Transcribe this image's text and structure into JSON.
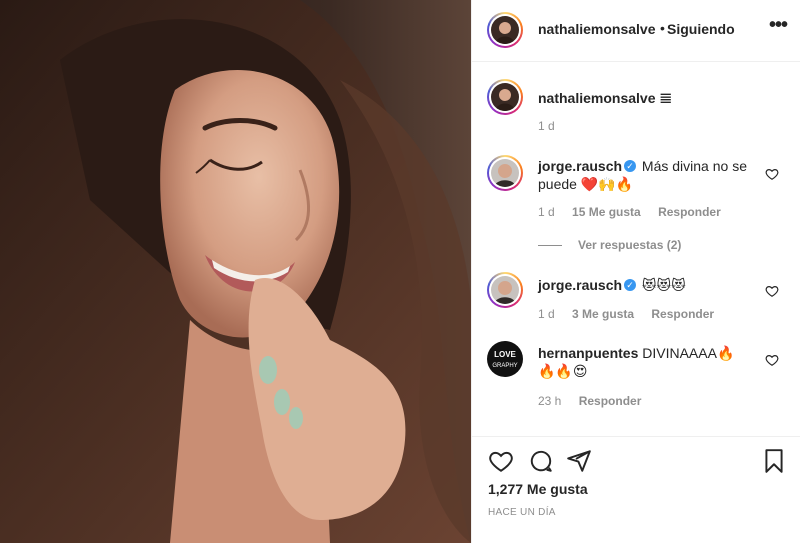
{
  "post": {
    "image_alt": "woman smiling with hand near mouth"
  },
  "header": {
    "username": "nathaliemonsalve",
    "separator": "•",
    "follow_status": "Siguiendo",
    "more_label": "•••"
  },
  "caption": {
    "username": "nathaliemonsalve",
    "emoji": "𝌆",
    "age": "1 d"
  },
  "comments": [
    {
      "username": "jorge.rausch",
      "verified": true,
      "text": "Más divina no se puede ❤️🙌🔥",
      "age": "1 d",
      "likes": "15 Me gusta",
      "reply": "Responder",
      "view_replies": "Ver respuestas (2)"
    },
    {
      "username": "jorge.rausch",
      "verified": true,
      "text": "😻😻😻",
      "age": "1 d",
      "likes": "3 Me gusta",
      "reply": "Responder"
    },
    {
      "username": "hernanpuentes",
      "verified": false,
      "text": "DIVINAAAA🔥🔥🔥😍",
      "age": "23 h",
      "reply": "Responder"
    }
  ],
  "footer": {
    "likes": "1,277 Me gusta",
    "time": "HACE UN DÍA"
  },
  "icons": {
    "heart": "heart-icon",
    "comment": "comment-icon",
    "share": "share-icon",
    "save": "bookmark-icon"
  }
}
